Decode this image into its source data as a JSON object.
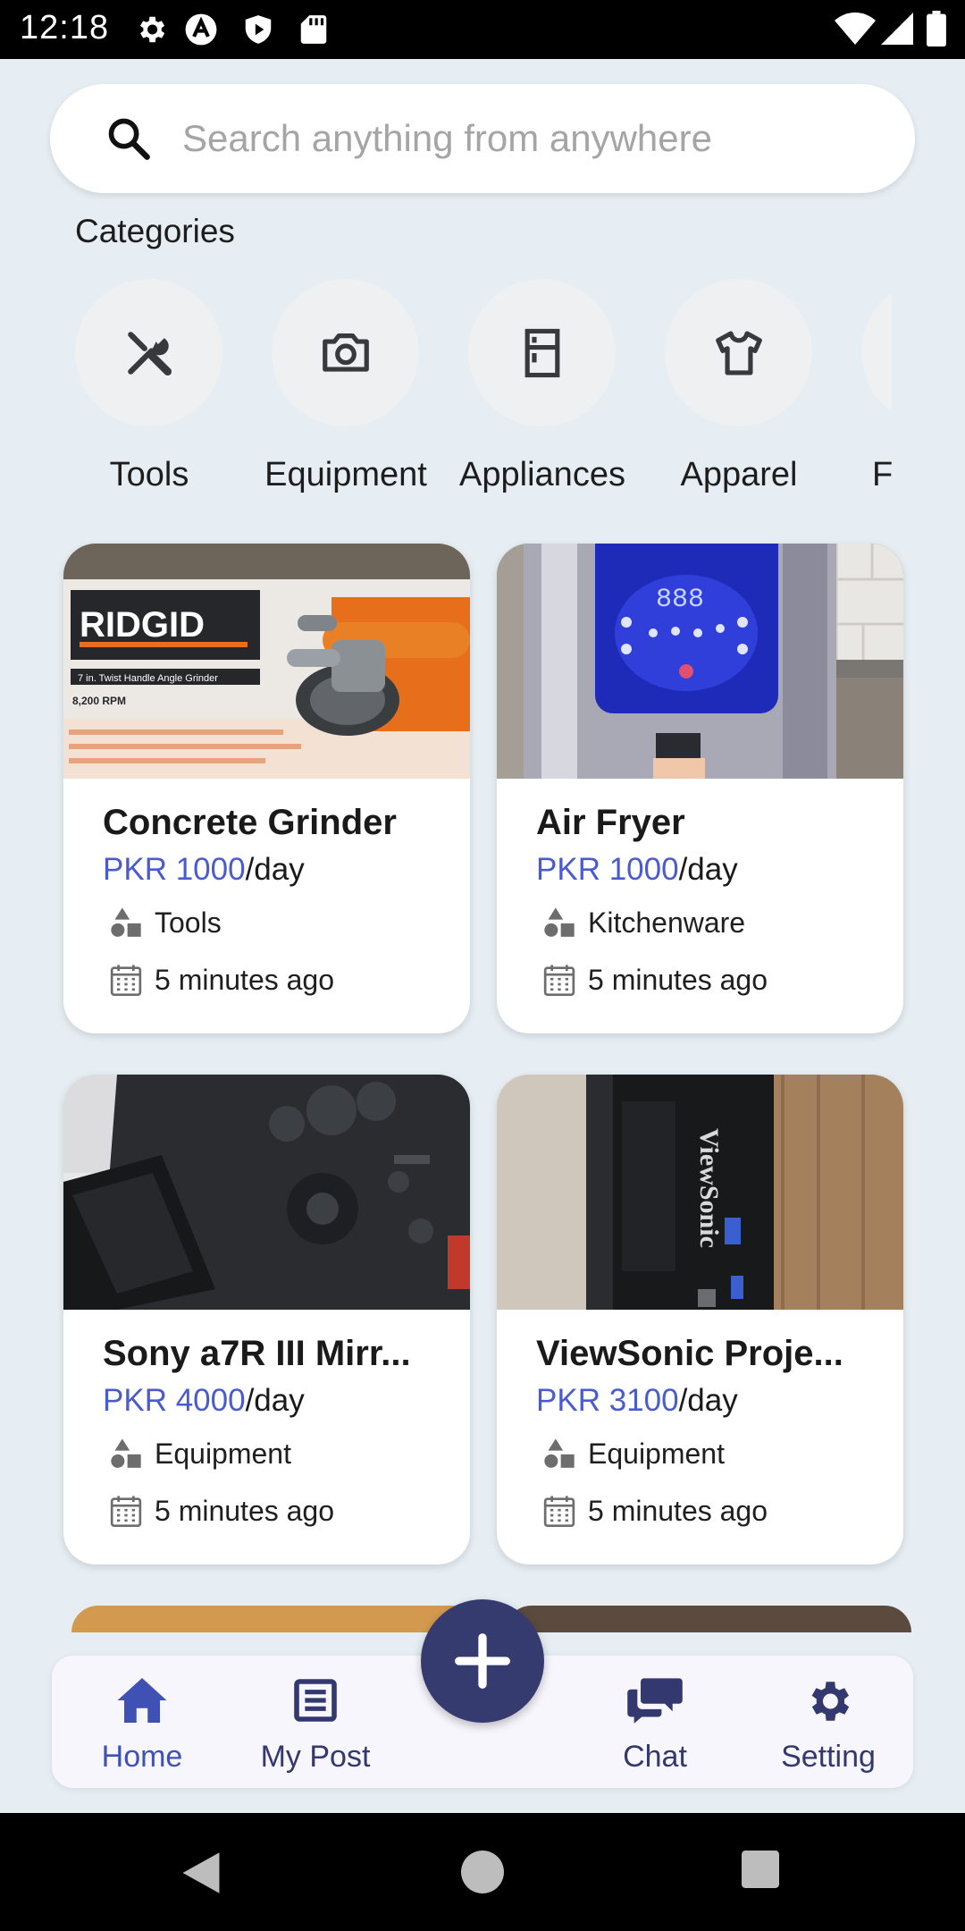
{
  "status_bar": {
    "time": "12:18",
    "left_icons": [
      "gear-icon",
      "a-logo-icon",
      "play-shield-icon",
      "sd-card-icon"
    ],
    "right_icons": [
      "wifi-icon",
      "signal-icon",
      "battery-icon"
    ]
  },
  "search": {
    "placeholder": "Search anything from anywhere",
    "icon": "search-icon"
  },
  "categories": {
    "title": "Categories",
    "items": [
      {
        "label": "Tools",
        "icon": "tools-icon"
      },
      {
        "label": "Equipment",
        "icon": "camera-icon"
      },
      {
        "label": "Appliances",
        "icon": "fridge-icon"
      },
      {
        "label": "Apparel",
        "icon": "shirt-icon"
      },
      {
        "label": "F",
        "icon": ""
      }
    ]
  },
  "products": [
    {
      "title": "Concrete Grinder",
      "price_amount": "PKR 1000",
      "price_unit": "/day",
      "category": "Tools",
      "posted": "5 minutes ago",
      "image": "angle-grinder-box"
    },
    {
      "title": "Air Fryer",
      "price_amount": "PKR 1000",
      "price_unit": "/day",
      "category": "Kitchenware",
      "posted": "5 minutes ago",
      "image": "air-fryer",
      "image_text": "888"
    },
    {
      "title": "Sony a7R III Mirr...",
      "price_amount": "PKR 4000",
      "price_unit": "/day",
      "category": "Equipment",
      "posted": "5 minutes ago",
      "image": "camera"
    },
    {
      "title": "ViewSonic Proje...",
      "price_amount": "PKR 3100",
      "price_unit": "/day",
      "category": "Equipment",
      "posted": "5 minutes ago",
      "image": "projector"
    }
  ],
  "image_text": {
    "ridgid_logo": "RIDGID",
    "ridgid_line1": "7 in. Twist Handle Angle Grinder",
    "ridgid_line2": "8,200 RPM",
    "viewsonic_logo": "ViewSonic"
  },
  "bottom_nav": {
    "items": [
      {
        "label": "Home",
        "icon": "home-icon",
        "active": true
      },
      {
        "label": "My Post",
        "icon": "post-icon",
        "active": false
      },
      {
        "label": "Chat",
        "icon": "chat-icon",
        "active": false
      },
      {
        "label": "Setting",
        "icon": "gear-icon",
        "active": false
      }
    ],
    "fab_icon": "plus-icon"
  },
  "colors": {
    "background": "#e6eef3",
    "accent": "#3f51b5",
    "price": "#4a5bcd",
    "fab": "#353a6f",
    "nav_text": "#33396e"
  }
}
